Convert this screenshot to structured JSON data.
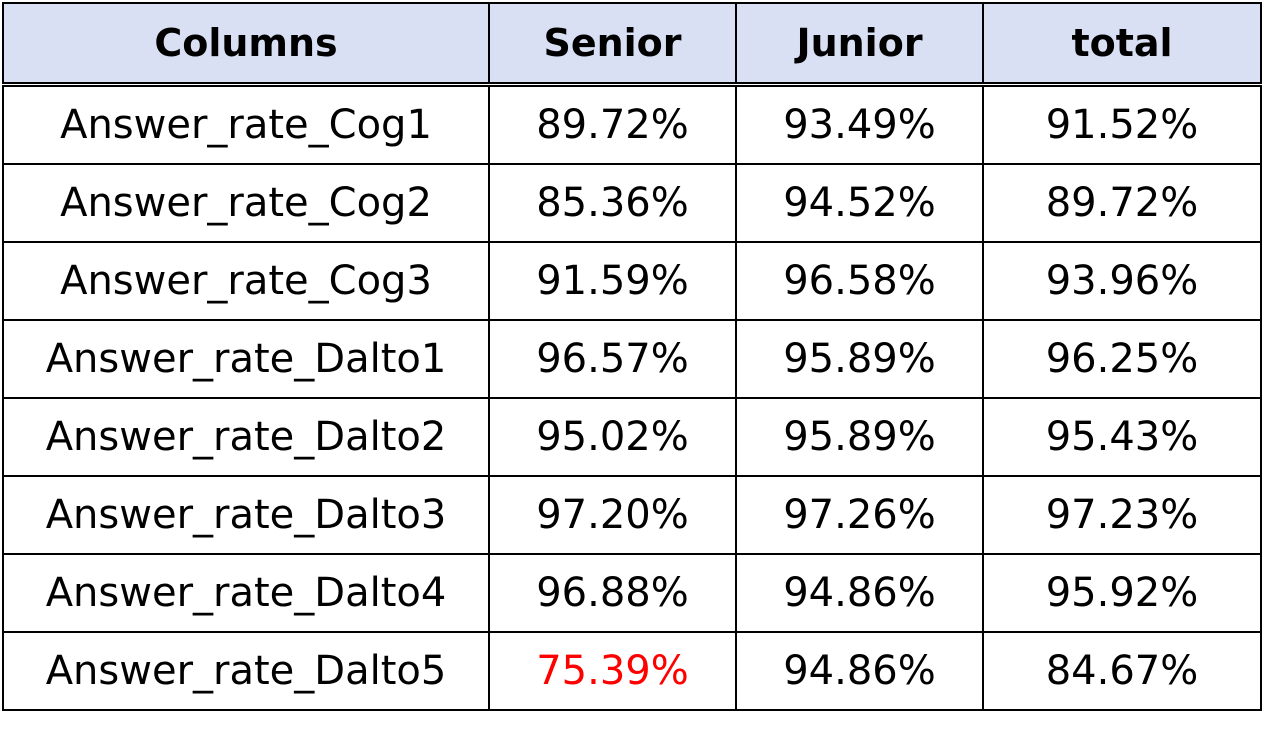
{
  "table": {
    "headers": [
      "Columns",
      "Senior",
      "Junior",
      "total"
    ],
    "rows": [
      {
        "label": "Answer_rate_Cog1",
        "senior": "89.72%",
        "junior": "93.49%",
        "total": "91.52%"
      },
      {
        "label": "Answer_rate_Cog2",
        "senior": "85.36%",
        "junior": "94.52%",
        "total": "89.72%"
      },
      {
        "label": "Answer_rate_Cog3",
        "senior": "91.59%",
        "junior": "96.58%",
        "total": "93.96%"
      },
      {
        "label": "Answer_rate_Dalto1",
        "senior": "96.57%",
        "junior": "95.89%",
        "total": "96.25%"
      },
      {
        "label": "Answer_rate_Dalto2",
        "senior": "95.02%",
        "junior": "95.89%",
        "total": "95.43%"
      },
      {
        "label": "Answer_rate_Dalto3",
        "senior": "97.20%",
        "junior": "97.26%",
        "total": "97.23%"
      },
      {
        "label": "Answer_rate_Dalto4",
        "senior": "96.88%",
        "junior": "94.86%",
        "total": "95.92%"
      },
      {
        "label": "Answer_rate_Dalto5",
        "senior": "75.39%",
        "junior": "94.86%",
        "total": "84.67%"
      }
    ],
    "header_background": "#d9e0f3",
    "highlight_color": "#ff0000",
    "highlighted_cell": "Answer_rate_Dalto5 / Senior"
  }
}
